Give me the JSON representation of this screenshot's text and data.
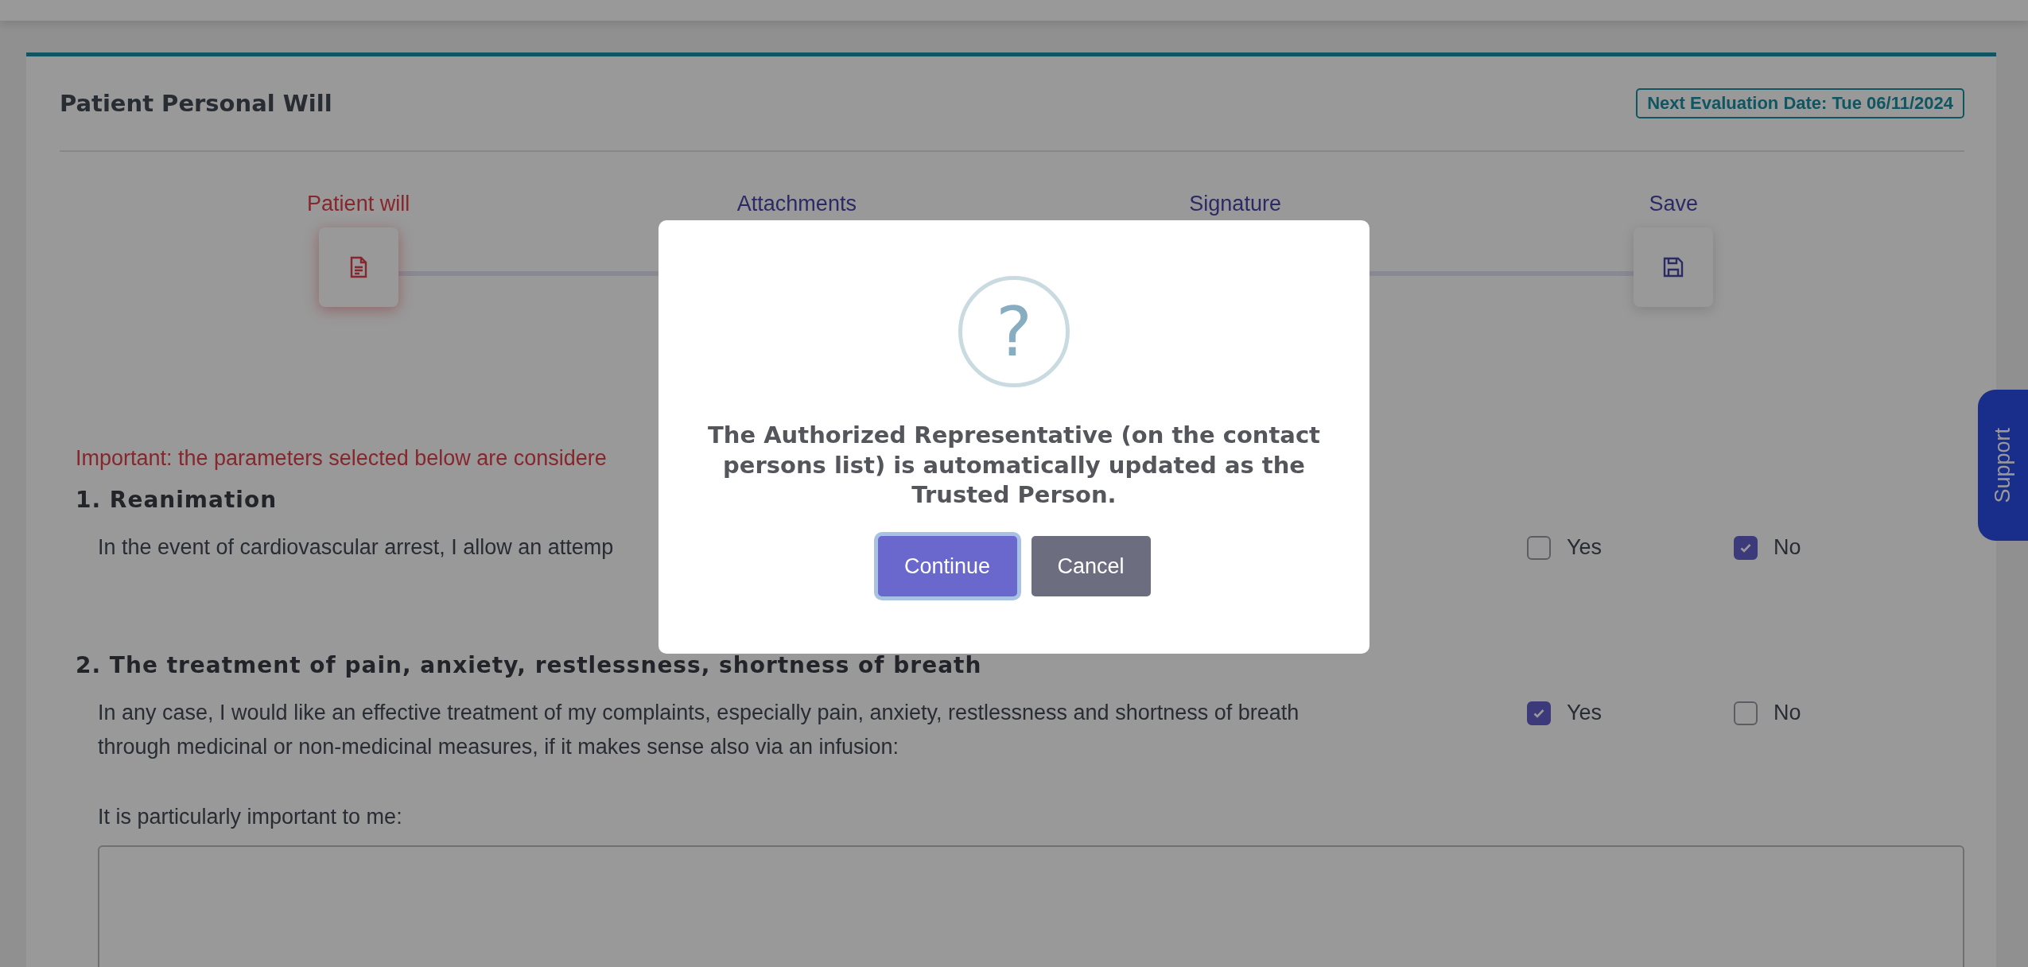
{
  "card": {
    "title": "Patient Personal Will",
    "evaluation_badge": "Next Evaluation Date: Tue 06/11/2024"
  },
  "steps": [
    {
      "label": "Patient will",
      "selected": true,
      "kind": "document"
    },
    {
      "label": "Attachments",
      "selected": false
    },
    {
      "label": "Signature",
      "selected": false
    },
    {
      "label": "Save",
      "selected": false,
      "kind": "save"
    }
  ],
  "notice": "Important: the parameters selected below are considere",
  "questions": [
    {
      "heading": "1. Reanimation",
      "text": "In the event of cardiovascular arrest, I allow an attemp",
      "options": [
        {
          "label": "Yes",
          "checked": false
        },
        {
          "label": "No",
          "checked": true
        }
      ]
    },
    {
      "heading": "2. The treatment of pain, anxiety, restlessness, shortness of breath",
      "text": "In any case, I would like an effective treatment of my complaints, especially pain, anxiety, restlessness and shortness of breath through medicinal or non-medicinal measures, if it makes sense also via an infusion:",
      "options": [
        {
          "label": "Yes",
          "checked": true
        },
        {
          "label": "No",
          "checked": false
        }
      ],
      "note": "It is particularly important to me:",
      "answer_field": {
        "kind": "textarea"
      }
    }
  ],
  "support_tab": "Support",
  "dialog": {
    "icon": "?",
    "message": "The Authorized Representative (on the contact persons list) is automatically updated as the Trusted Person.",
    "buttons": [
      {
        "label": "Continue",
        "kind": "primary",
        "focused": true
      },
      {
        "label": "Cancel",
        "kind": "secondary",
        "focused": false
      }
    ]
  }
}
